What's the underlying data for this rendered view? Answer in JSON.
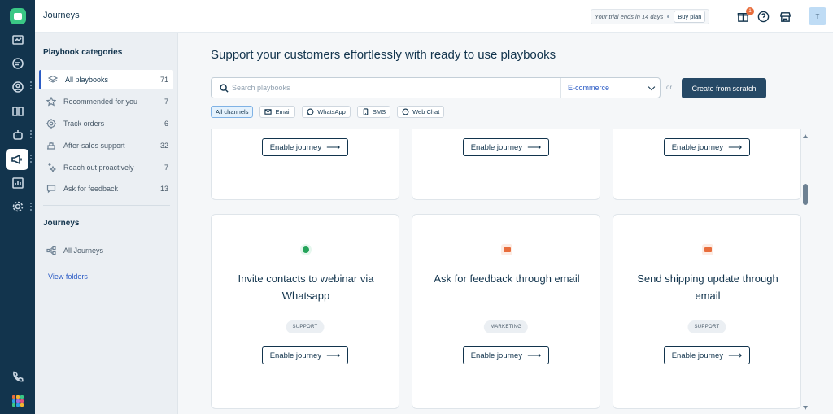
{
  "topbar": {
    "title": "Journeys",
    "trial_text": "Your trial ends in 14 days",
    "buy_label": "Buy plan",
    "notification_count": "1",
    "avatar_initial": "T"
  },
  "sidebar": {
    "categories_heading": "Playbook categories",
    "categories": [
      {
        "label": "All playbooks",
        "count": "71",
        "icon": "layers-icon"
      },
      {
        "label": "Recommended for you",
        "count": "7",
        "icon": "star-icon"
      },
      {
        "label": "Track orders",
        "count": "6",
        "icon": "target-icon"
      },
      {
        "label": "After-sales support",
        "count": "32",
        "icon": "box-icon"
      },
      {
        "label": "Reach out proactively",
        "count": "7",
        "icon": "sparkle-icon"
      },
      {
        "label": "Ask for feedback",
        "count": "13",
        "icon": "chat-icon"
      }
    ],
    "journeys_heading": "Journeys",
    "all_journeys": "All Journeys",
    "view_folders": "View folders"
  },
  "main": {
    "heading": "Support your customers effortlessly with ready to use playbooks",
    "search_placeholder": "Search playbooks",
    "industry_selected": "E-commerce",
    "or_text": "or",
    "create_label": "Create from scratch",
    "channels": [
      {
        "label": "All channels",
        "icon": ""
      },
      {
        "label": "Email",
        "icon": "email-icon"
      },
      {
        "label": "WhatsApp",
        "icon": "whatsapp-icon"
      },
      {
        "label": "SMS",
        "icon": "phone-icon"
      },
      {
        "label": "Web Chat",
        "icon": "webchat-icon"
      }
    ],
    "enable_label": "Enable journey",
    "cards": [
      {
        "title": "Invite contacts to webinar via Whatsapp",
        "tag": "SUPPORT",
        "channel": "whatsapp-icon"
      },
      {
        "title": "Ask for feedback through email",
        "tag": "MARKETING",
        "channel": "email-icon"
      },
      {
        "title": "Send shipping update through email",
        "tag": "SUPPORT",
        "channel": "email-icon"
      }
    ]
  },
  "colors": {
    "rail": "#12344d",
    "accent": "#2c5cc5",
    "primary_button": "#264966",
    "whatsapp": "#25a35a",
    "email": "#e86d3c"
  }
}
